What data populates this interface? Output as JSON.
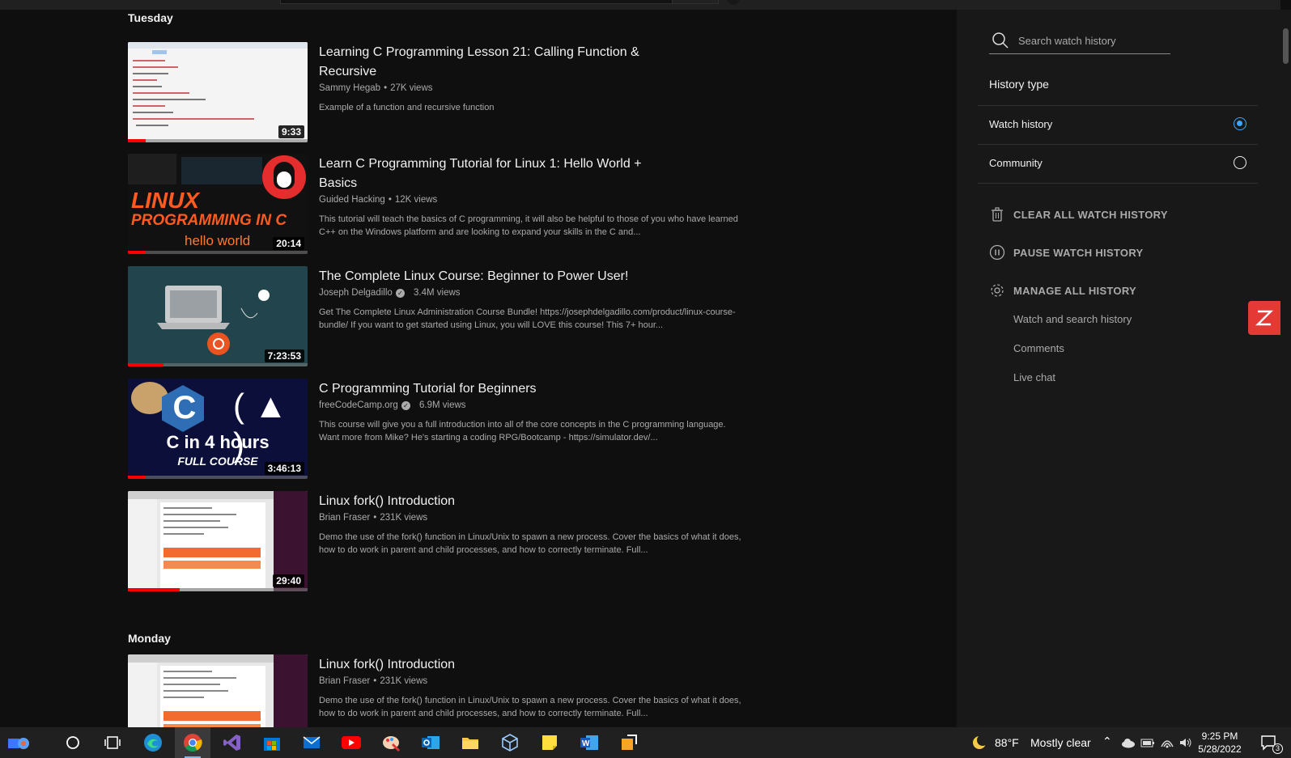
{
  "sections": [
    {
      "title": "Tuesday",
      "videos": [
        {
          "title_l1": "Learning C Programming Lesson 21: Calling Function &",
          "title_l2": "Recursive",
          "channel": "Sammy Hegab",
          "views": "27K views",
          "verified": false,
          "description": "Example of a function and recursive function",
          "duration": "9:33",
          "progress": 0.1
        },
        {
          "title_l1": "Learn C Programming Tutorial for Linux 1: Hello World +",
          "title_l2": "Basics",
          "channel": "Guided Hacking",
          "views": "12K views",
          "verified": false,
          "description": "This tutorial will teach the basics of C programming, it will also be helpful to those of you who have learned C++ on the Windows platform and are looking to expand your skills in the C and...",
          "duration": "20:14",
          "progress": 0.1
        },
        {
          "title_l1": "The Complete Linux Course: Beginner to Power User!",
          "title_l2": "",
          "channel": "Joseph Delgadillo",
          "views": "3.4M views",
          "verified": true,
          "description": "Get The Complete Linux Administration Course Bundle! https://josephdelgadillo.com/product/linux-course-bundle/ If you want to get started using Linux, you will LOVE this course! This 7+ hour...",
          "duration": "7:23:53",
          "progress": 0.2
        },
        {
          "title_l1": "C Programming Tutorial for Beginners",
          "title_l2": "",
          "channel": "freeCodeCamp.org",
          "views": "6.9M views",
          "verified": true,
          "description": "This course will give you a full introduction into all of the core concepts in the C programming language. Want more from Mike? He's starting a coding RPG/Bootcamp - https://simulator.dev/...",
          "duration": "3:46:13",
          "progress": 0.1
        },
        {
          "title_l1": "Linux fork() Introduction",
          "title_l2": "",
          "channel": "Brian Fraser",
          "views": "231K views",
          "verified": false,
          "description": "Demo the use of the fork() function in Linux/Unix to spawn a new process. Cover the basics of what it does, how to do work in parent and child processes, and how to correctly terminate. Full...",
          "duration": "29:40",
          "progress": 0.29
        }
      ]
    },
    {
      "title": "Monday",
      "videos": [
        {
          "title_l1": "Linux fork() Introduction",
          "title_l2": "",
          "channel": "Brian Fraser",
          "views": "231K views",
          "verified": false,
          "description": "Demo the use of the fork() function in Linux/Unix to spawn a new process. Cover the basics of what it does, how to do work in parent and child processes, and how to correctly terminate. Full...",
          "duration": "29:40",
          "progress": 0.29
        }
      ]
    }
  ],
  "thumb_text": {
    "linux_l1": "LINUX",
    "linux_l2": "PROGRAMMING IN C",
    "linux_l3": "hello world",
    "c_letter": "C",
    "c_hours": "C in 4 hours",
    "c_course": "FULL COURSE"
  },
  "sidebar": {
    "search_placeholder": "Search watch history",
    "history_type_label": "History type",
    "options": [
      {
        "label": "Watch history",
        "selected": true
      },
      {
        "label": "Community",
        "selected": false
      }
    ],
    "actions": {
      "clear": "CLEAR ALL WATCH HISTORY",
      "pause": "PAUSE WATCH HISTORY",
      "manage": "MANAGE ALL HISTORY"
    },
    "sublinks": [
      "Watch and search history",
      "Comments",
      "Live chat"
    ]
  },
  "taskbar": {
    "weather": {
      "temp": "88°F",
      "condition": "Mostly clear"
    },
    "time": "9:25 PM",
    "date": "5/28/2022",
    "notification_count": "3",
    "apps": [
      "widgets-icon",
      "search-circle-icon",
      "task-view-icon",
      "edge-icon",
      "chrome-icon",
      "visual-studio-icon",
      "store-icon",
      "mail-icon",
      "youtube-icon",
      "paint-icon",
      "outlook-icon",
      "file-explorer-icon",
      "3d-viewer-icon",
      "sticky-notes-icon",
      "word-icon",
      "app-icon"
    ]
  },
  "colors": {
    "accent": "#3ea6ff",
    "progress": "#ff0000",
    "background": "#0f0f0f",
    "sidebar": "#181818"
  }
}
